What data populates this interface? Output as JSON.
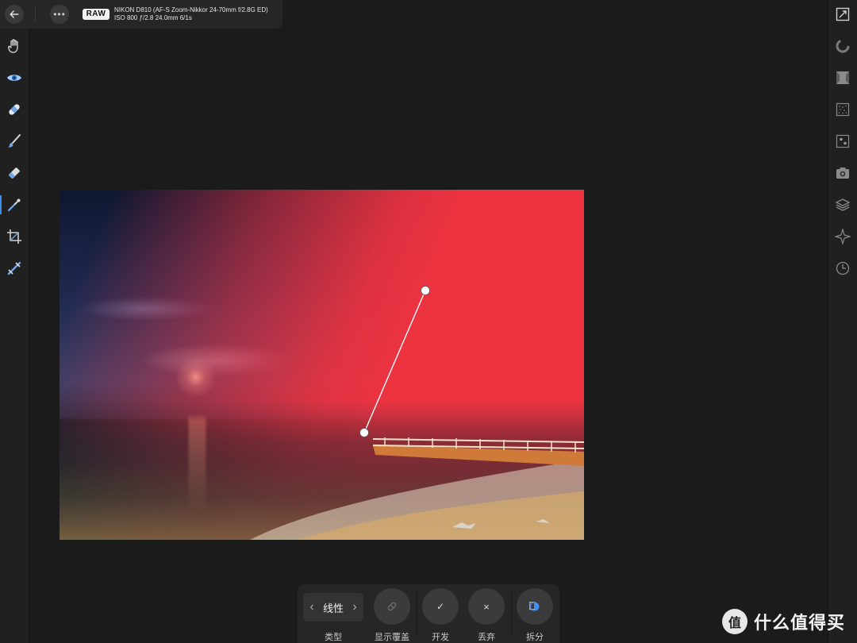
{
  "header": {
    "raw_badge": "RAW",
    "camera": "NIKON D810 (AF-S Zoom-Nikkor 24-70mm f/2.8G ED)",
    "exposure": "ISO 800 ƒ/2.8 24.0mm 6/1s",
    "more_label": "•••"
  },
  "left_tools": [
    {
      "name": "hand-tool-icon",
      "icon": "hand"
    },
    {
      "name": "eye-tool-icon",
      "icon": "eye"
    },
    {
      "name": "bandage-tool-icon",
      "icon": "bandage"
    },
    {
      "name": "brush-tool-icon",
      "icon": "brush"
    },
    {
      "name": "eraser-tool-icon",
      "icon": "eraser"
    },
    {
      "name": "gradient-tool-icon",
      "icon": "gradient",
      "active": true
    },
    {
      "name": "crop-tool-icon",
      "icon": "crop"
    },
    {
      "name": "selection-tool-icon",
      "icon": "selection"
    }
  ],
  "right_tools": [
    {
      "name": "fullscreen-icon",
      "icon": "fullscreen"
    },
    {
      "name": "histogram-icon",
      "icon": "histogram"
    },
    {
      "name": "basic-adjust-icon",
      "icon": "square"
    },
    {
      "name": "noise-icon",
      "icon": "noise"
    },
    {
      "name": "detail-icon",
      "icon": "detail"
    },
    {
      "name": "camera-icon",
      "icon": "camera"
    },
    {
      "name": "layers-icon",
      "icon": "layers"
    },
    {
      "name": "navigator-icon",
      "icon": "navigator"
    },
    {
      "name": "history-icon",
      "icon": "history"
    }
  ],
  "gradient_panel": {
    "type_value": "线性",
    "type_label": "类型",
    "overlay_label": "显示覆盖",
    "develop_label": "开发",
    "discard_label": "丢弃",
    "split_label": "拆分",
    "develop_symbol": "✓",
    "discard_symbol": "×"
  },
  "watermark": {
    "logo_text": "值",
    "text": "什么值得买"
  },
  "colors": {
    "accent": "#3d8ff0",
    "overlay_red": "#ee3340"
  }
}
